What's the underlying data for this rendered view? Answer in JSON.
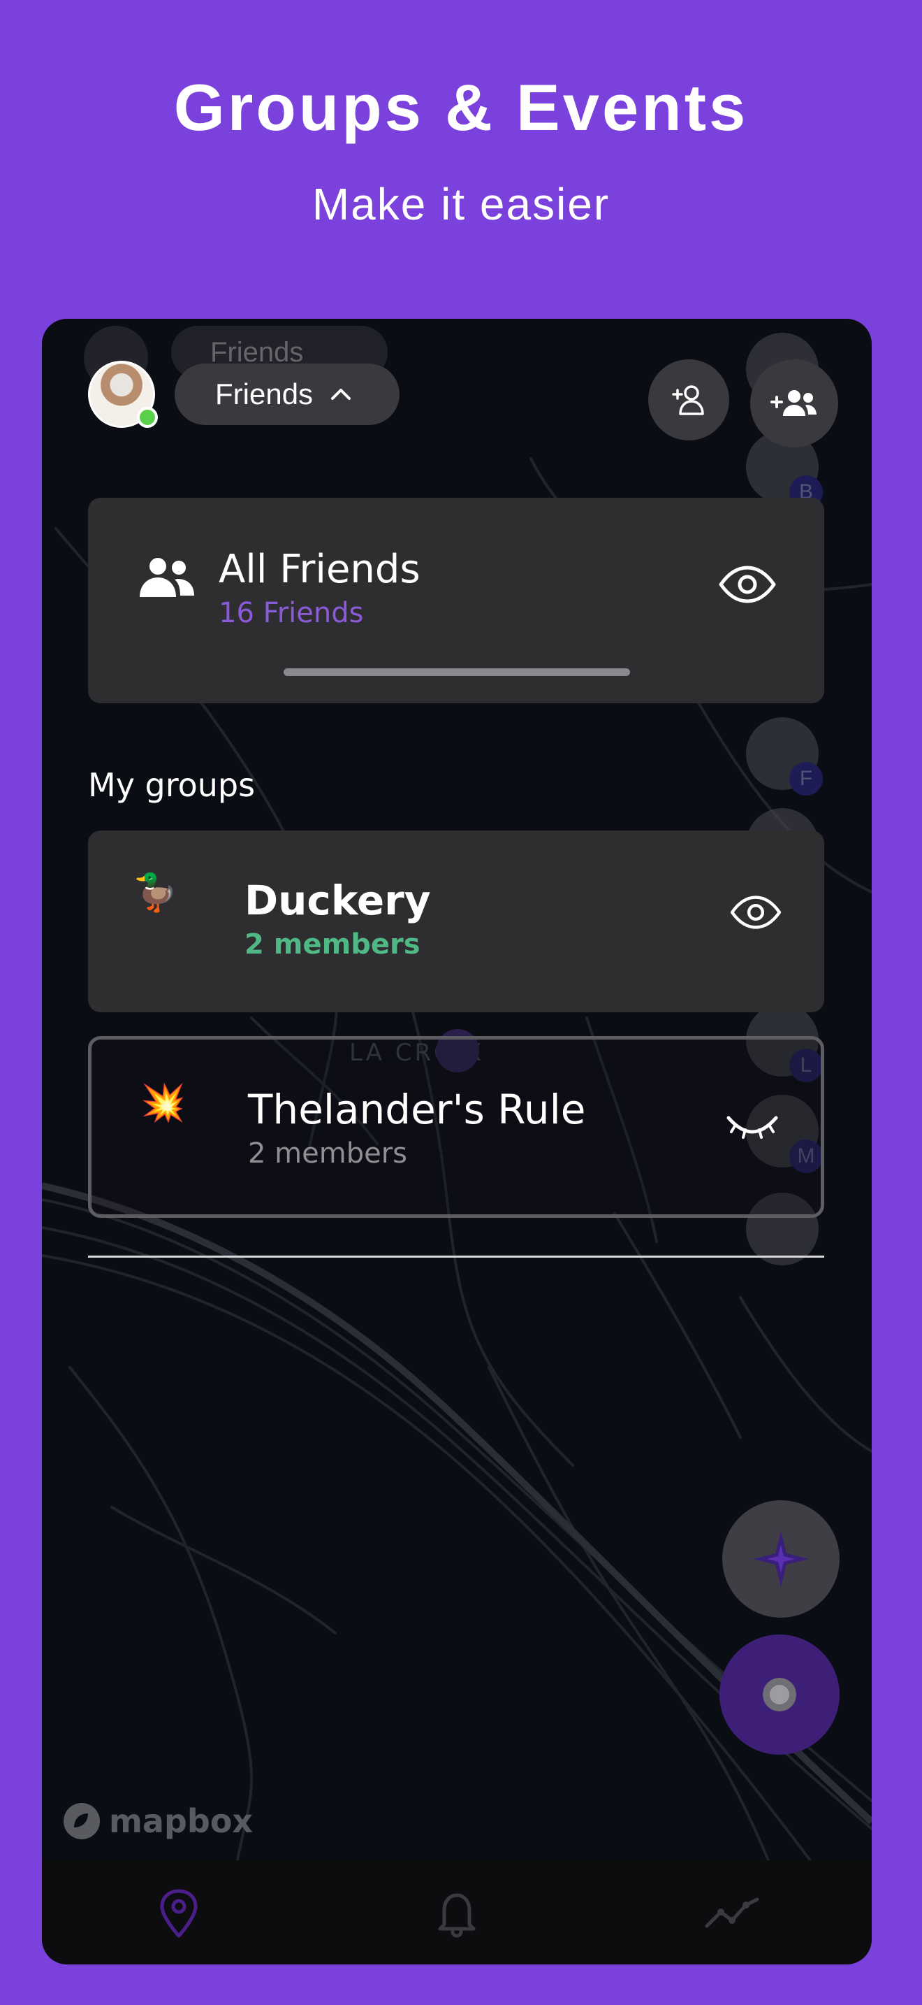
{
  "headline": "Groups & Events",
  "subline": "Make it easier",
  "topbar": {
    "filter_label": "Friends",
    "ghost_filter_label": "Friends",
    "add_friend_icon": "add-person-icon",
    "add_group_icon": "add-group-icon"
  },
  "all_friends": {
    "title": "All Friends",
    "count": "16 Friends",
    "icon": "people-icon",
    "visibility_icon": "eye-icon"
  },
  "groups_section": {
    "label": "My groups",
    "groups": [
      {
        "emoji": "🦆",
        "name": "Duckery",
        "members": "2 members",
        "members_color": "#4fb885",
        "visible": true
      },
      {
        "emoji": "💥",
        "name": "Thelander's Rule",
        "members": "2 members",
        "members_color": "#8e8e93",
        "visible": false
      }
    ]
  },
  "map": {
    "place_label": "LA CROIX",
    "attribution": "mapbox"
  },
  "right_avatars": {
    "letters": [
      "B",
      "F",
      "L",
      "M"
    ]
  },
  "fabs": {
    "compass_icon": "compass-icon",
    "locate_icon": "target-icon"
  },
  "tabs": [
    {
      "name": "map-tab",
      "icon": "location-pin-icon",
      "active": true
    },
    {
      "name": "notifications-tab",
      "icon": "bell-icon",
      "active": false
    },
    {
      "name": "activity-tab",
      "icon": "trend-icon",
      "active": false
    }
  ],
  "colors": {
    "background": "#7a41dc",
    "accent": "#8b5ad8",
    "panel": "#2e2e31",
    "map": "#0b0d14"
  }
}
